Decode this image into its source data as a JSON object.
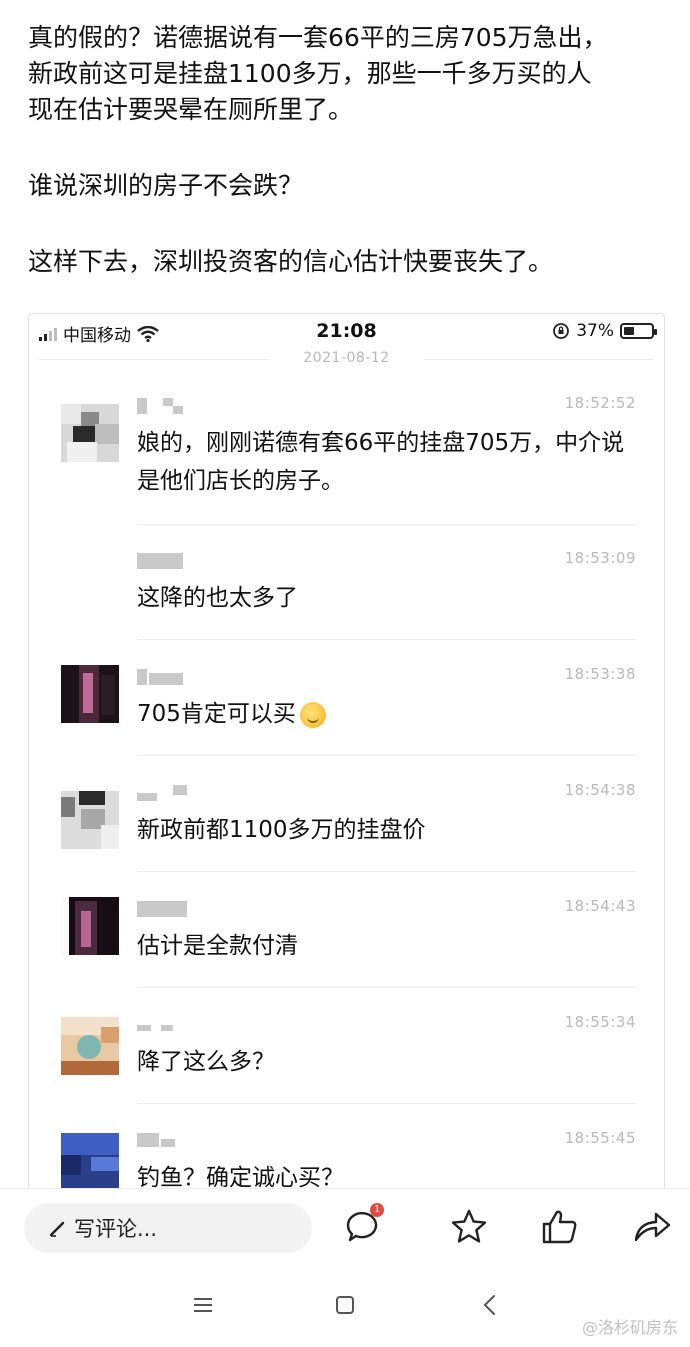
{
  "post": {
    "line1": "真的假的？诺德据说有一套66平的三房705万急出，",
    "line2": "新政前这可是挂盘1100多万，那些一千多万买的人",
    "line3": "现在估计要哭晕在厕所里了。",
    "line4": "谁说深圳的房子不会跌？",
    "line5": "这样下去，深圳投资客的信心估计快要丧失了。"
  },
  "status_bar": {
    "carrier": "中国移动",
    "time": "21:08",
    "battery_text": "37%",
    "battery_level": 0.37
  },
  "chat": {
    "date": "2021-08-12",
    "messages": [
      {
        "time": "18:52:52",
        "text": "娘的，刚刚诺德有套66平的挂盘705万，中介说是他们店长的房子。"
      },
      {
        "time": "18:53:09",
        "text": "这降的也太多了"
      },
      {
        "time": "18:53:38",
        "text": "705肯定可以买"
      },
      {
        "time": "18:54:38",
        "text": "新政前都1100多万的挂盘价"
      },
      {
        "time": "18:54:43",
        "text": "估计是全款付清"
      },
      {
        "time": "18:55:34",
        "text": "降了这么多？"
      },
      {
        "time": "18:55:45",
        "text": "钓鱼？确定诚心买？"
      }
    ]
  },
  "action_bar": {
    "comment_placeholder": "写评论...",
    "comment_badge": "1"
  },
  "watermark": "@洛杉矶房东"
}
